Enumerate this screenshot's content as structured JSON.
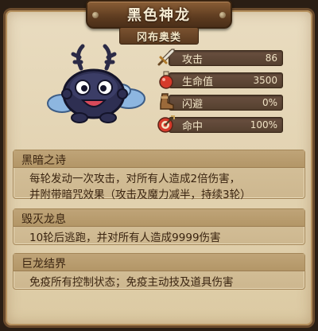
{
  "header": {
    "title": "黑色神龙",
    "subtitle": "冈布奥类"
  },
  "monster": {
    "icon": "black-dragon-blob-icon"
  },
  "stats": [
    {
      "icon": "sword-icon",
      "label": "攻击",
      "value": "86"
    },
    {
      "icon": "health-potion-icon",
      "label": "生命值",
      "value": "3500"
    },
    {
      "icon": "boot-icon",
      "label": "闪避",
      "value": "0%"
    },
    {
      "icon": "target-icon",
      "label": "命中",
      "value": "100%"
    }
  ],
  "skills": [
    {
      "name": "黑暗之诗",
      "desc_lines": [
        "每轮发动一次攻击，对所有人造成2倍伤害，",
        "并附带暗咒效果（攻击及魔力减半，持续3轮）"
      ]
    },
    {
      "name": "毁灭龙息",
      "desc_lines": [
        "10轮后逃跑，并对所有人造成9999伤害"
      ]
    },
    {
      "name": "巨龙结界",
      "desc_lines": [
        "免疫所有控制状态；免疫主动技及道具伤害"
      ]
    }
  ]
}
